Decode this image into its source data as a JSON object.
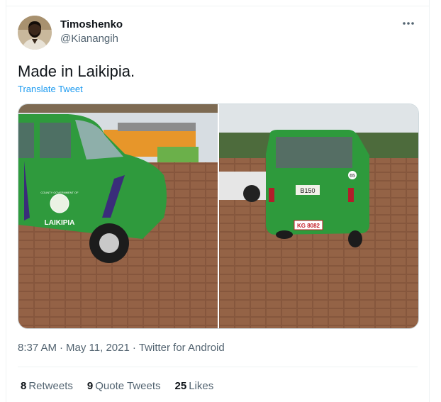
{
  "author": {
    "display_name": "Timoshenko",
    "handle": "@Kianangih"
  },
  "tweet": {
    "text": "Made in Laikipia.",
    "translate_label": "Translate Tweet"
  },
  "media": {
    "photo_left": {
      "side_text": "LAIKIPIA",
      "emblem_text": "COUNTY GOVERNMENT OF"
    },
    "photo_right": {
      "plate_front": "B150",
      "plate_rear": "KG 8082",
      "sticker": "65"
    }
  },
  "meta": {
    "time": "8:37 AM",
    "date": "May 11, 2021",
    "source": "Twitter for Android"
  },
  "stats": {
    "retweets_count": "8",
    "retweets_label": "Retweets",
    "quotes_count": "9",
    "quotes_label": "Quote Tweets",
    "likes_count": "25",
    "likes_label": "Likes"
  },
  "colors": {
    "accent": "#1d9bf0",
    "secondary_text": "#536471",
    "vehicle_green": "#2e9a3c"
  }
}
